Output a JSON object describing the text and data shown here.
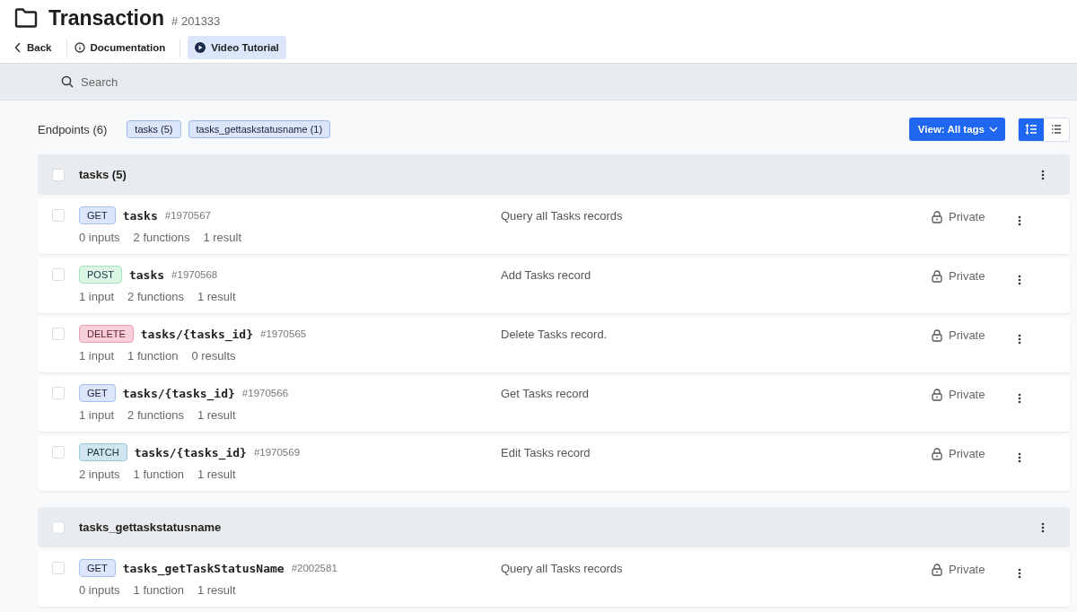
{
  "header": {
    "title": "Transaction",
    "id": "# 201333"
  },
  "nav": [
    {
      "label": "Back",
      "kind": "back",
      "selected": false
    },
    {
      "label": "Documentation",
      "kind": "info",
      "selected": false
    },
    {
      "label": "Video Tutorial",
      "kind": "play",
      "selected": true
    }
  ],
  "search": {
    "placeholder": "Search"
  },
  "toolbar": {
    "label": "Endpoints (6)",
    "tags": [
      "tasks (5)",
      "tasks_gettaskstatusname (1)"
    ],
    "view_button": "View: All tags",
    "layouts": [
      {
        "kind": "detailed",
        "selected": true
      },
      {
        "kind": "list",
        "selected": false
      }
    ]
  },
  "groups": [
    {
      "name": "tasks (5)",
      "checked": false,
      "endpoints": [
        {
          "method": "GET",
          "kind": "get",
          "path": "tasks",
          "id": "#1970567",
          "description": "Query all Tasks records",
          "access": "Private",
          "checked": false,
          "stats": [
            "0 inputs",
            "2 functions",
            "1 result"
          ]
        },
        {
          "method": "POST",
          "kind": "post",
          "path": "tasks",
          "id": "#1970568",
          "description": "Add Tasks record",
          "access": "Private",
          "checked": false,
          "stats": [
            "1 input",
            "2 functions",
            "1 result"
          ]
        },
        {
          "method": "DELETE",
          "kind": "delete",
          "path": "tasks/{tasks_id}",
          "id": "#1970565",
          "description": "Delete Tasks record.",
          "access": "Private",
          "checked": false,
          "stats": [
            "1 input",
            "1 function",
            "0 results"
          ]
        },
        {
          "method": "GET",
          "kind": "get",
          "path": "tasks/{tasks_id}",
          "id": "#1970566",
          "description": "Get Tasks record",
          "access": "Private",
          "checked": false,
          "stats": [
            "1 input",
            "2 functions",
            "1 result"
          ]
        },
        {
          "method": "PATCH",
          "kind": "patch",
          "path": "tasks/{tasks_id}",
          "id": "#1970569",
          "description": "Edit Tasks record",
          "access": "Private",
          "checked": false,
          "stats": [
            "2 inputs",
            "1 function",
            "1 result"
          ]
        }
      ]
    },
    {
      "name": "tasks_gettaskstatusname",
      "checked": false,
      "endpoints": [
        {
          "method": "GET",
          "kind": "get",
          "path": "tasks_getTaskStatusName",
          "id": "#2002581",
          "description": "Query all Tasks records",
          "access": "Private",
          "checked": false,
          "stats": [
            "0 inputs",
            "1 function",
            "1 result"
          ]
        }
      ]
    }
  ]
}
